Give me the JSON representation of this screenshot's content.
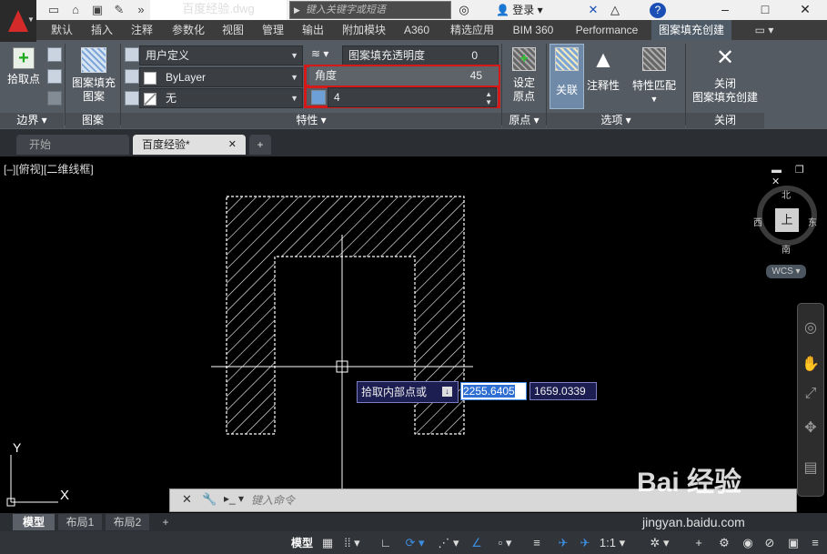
{
  "title_bar": {
    "document_title": "百度经验.dwg",
    "search_placeholder": "键入关键字或短语",
    "login_label": "登录",
    "help_icon": "?",
    "min_icon": "–",
    "max_icon": "□",
    "close_icon": "✕"
  },
  "ribbon_tabs": [
    "默认",
    "插入",
    "注释",
    "参数化",
    "视图",
    "管理",
    "输出",
    "附加模块",
    "A360",
    "精选应用",
    "BIM 360",
    "Performance",
    "图案填充创建"
  ],
  "ribbon_active_tab": "图案填充创建",
  "ribbon": {
    "boundary": {
      "pick_point": "拾取点",
      "panel_label": "边界"
    },
    "pattern": {
      "label_line1": "图案填充",
      "label_line2": "图案",
      "panel_label": "图案"
    },
    "properties": {
      "type_value": "用户定义",
      "transparency_label": "图案填充透明度",
      "transparency_value": "0",
      "color_value": "ByLayer",
      "angle_label": "角度",
      "angle_value": "45",
      "bg_value": "无",
      "spacing_value": "4",
      "panel_label": "特性"
    },
    "origin": {
      "set_line1": "设定",
      "set_line2": "原点",
      "panel_label": "原点"
    },
    "options": {
      "associative": "关联",
      "annotative": "注释性",
      "match_line1": "特性匹配",
      "panel_label": "选项"
    },
    "close": {
      "line1": "关闭",
      "line2": "图案填充创建",
      "panel_label": "关闭"
    }
  },
  "doc_tabs": {
    "start": "开始",
    "active": "百度经验*",
    "close": "✕",
    "add": "+"
  },
  "viewport": {
    "label": "[–][俯视][二维线框]",
    "compass_n": "北",
    "compass_s": "南",
    "compass_e": "东",
    "compass_w": "西",
    "cube_face": "上",
    "wcs": "WCS",
    "ucs_y": "Y",
    "ucs_x": "X"
  },
  "dynamic_input": {
    "prompt": "拾取内部点或",
    "x_value": "2255.6405",
    "y_value": "1659.0339"
  },
  "command_line": {
    "placeholder": "键入命令"
  },
  "layout_tabs": [
    "模型",
    "布局1",
    "布局2"
  ],
  "status_bar": {
    "model": "模型",
    "scale": "1:1"
  },
  "watermark": {
    "logo": "Bai  经验",
    "url": "jingyan.baidu.com"
  }
}
